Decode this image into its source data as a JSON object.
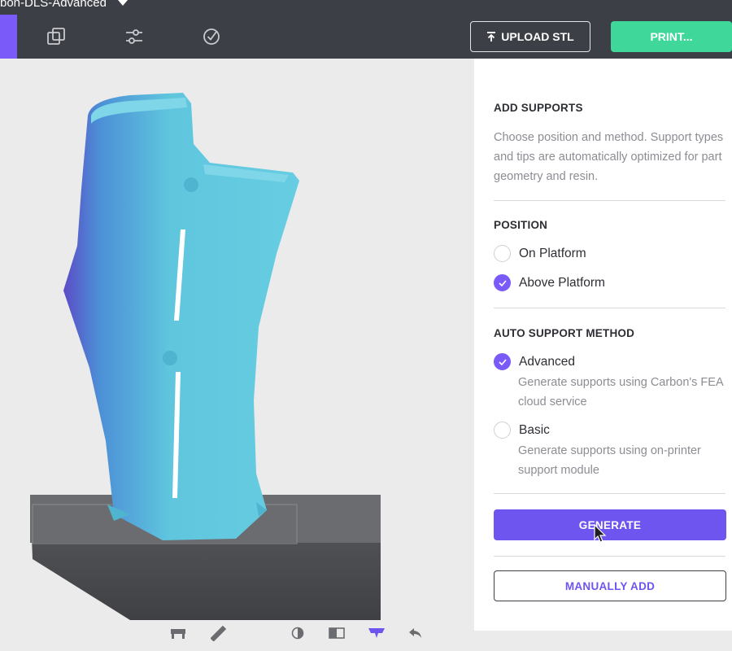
{
  "header": {
    "title": "bon-DLS-Advanced",
    "upload_label": "UPLOAD STL",
    "print_label": "PRINT...",
    "icons": [
      "layers-icon",
      "sliders-icon",
      "check-badge-icon"
    ]
  },
  "panel": {
    "add_supports_title": "ADD SUPPORTS",
    "add_supports_desc": "Choose position and method. Support types and tips are automatically optimized for part geometry and resin.",
    "position_title": "POSITION",
    "position_options": [
      {
        "label": "On Platform",
        "selected": false
      },
      {
        "label": "Above Platform",
        "selected": true
      }
    ],
    "method_title": "AUTO SUPPORT METHOD",
    "method_options": [
      {
        "label": "Advanced",
        "selected": true,
        "desc": "Generate supports using Carbon's FEA cloud service"
      },
      {
        "label": "Basic",
        "selected": false,
        "desc": "Generate supports using on-printer support module"
      }
    ],
    "generate_label": "GENERATE",
    "manual_label": "MANUALLY ADD"
  },
  "bottom_toolbar": {
    "icons": [
      "platform-view-icon",
      "ruler-icon",
      "orient-icon",
      "split-view-icon",
      "supports-icon",
      "undo-icon"
    ],
    "active": "supports-icon"
  },
  "colors": {
    "accent": "#7a5af8",
    "print": "#3fd79a",
    "topbar": "#3c3f46",
    "model": "#5fc6de"
  }
}
